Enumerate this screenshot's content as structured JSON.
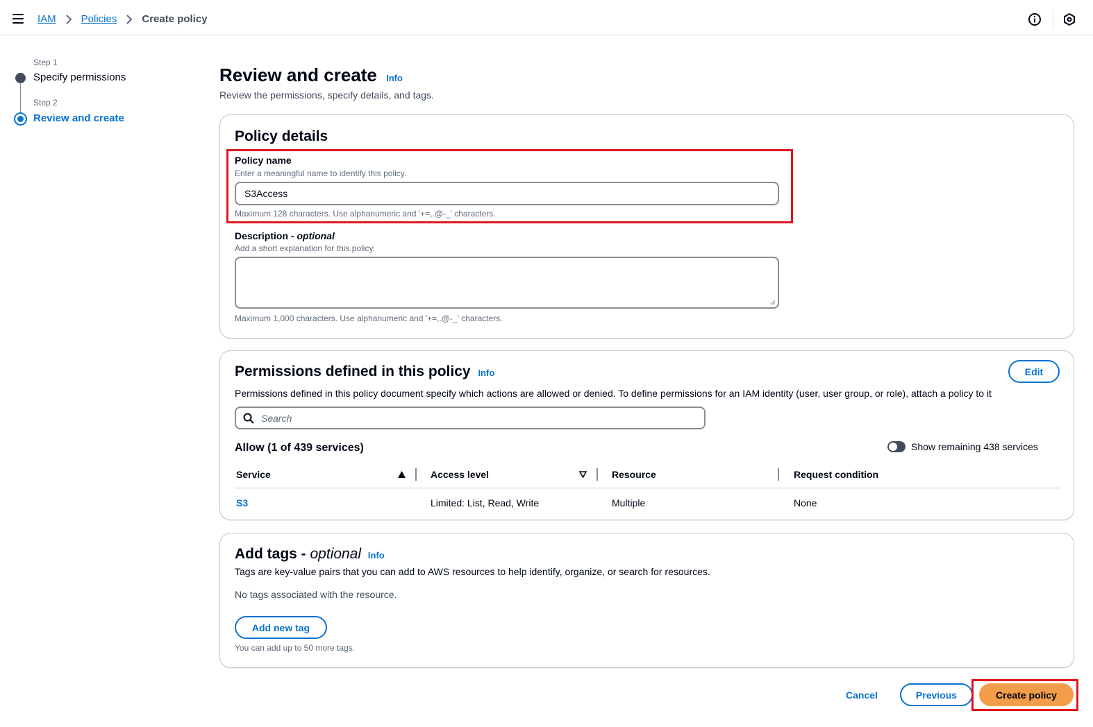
{
  "breadcrumb": {
    "items": [
      "IAM",
      "Policies"
    ],
    "current": "Create policy"
  },
  "steps": [
    {
      "step_label": "Step 1",
      "title": "Specify permissions",
      "state": "completed"
    },
    {
      "step_label": "Step 2",
      "title": "Review and create",
      "state": "current"
    }
  ],
  "page": {
    "title": "Review and create",
    "info": "Info",
    "description": "Review the permissions, specify details, and tags."
  },
  "policy_details": {
    "title": "Policy details",
    "name_label": "Policy name",
    "name_hint": "Enter a meaningful name to identify this policy.",
    "name_value": "S3Access",
    "name_constraint": "Maximum 128 characters. Use alphanumeric and '+=,.@-_' characters.",
    "description_label": "Description - ",
    "description_optional": "optional",
    "description_hint": "Add a short explanation for this policy.",
    "description_value": "",
    "description_constraint": "Maximum 1,000 characters. Use alphanumeric and '+=,.@-_' characters."
  },
  "permissions": {
    "title": "Permissions defined in this policy",
    "info": "Info",
    "edit_label": "Edit",
    "description": "Permissions defined in this policy document specify which actions are allowed or denied. To define permissions for an IAM identity (user, user group, or role), attach a policy to it",
    "search_placeholder": "Search",
    "allow_heading": "Allow (1 of 439 services)",
    "toggle_label": "Show remaining 438 services",
    "toggle_on": false,
    "columns": [
      "Service",
      "Access level",
      "Resource",
      "Request condition"
    ],
    "rows": [
      {
        "service": "S3",
        "access_level": "Limited: List, Read, Write",
        "resource": "Multiple",
        "request_condition": "None"
      }
    ]
  },
  "tags": {
    "title": "Add tags - ",
    "title_optional": "optional",
    "info": "Info",
    "description": "Tags are key-value pairs that you can add to AWS resources to help identify, organize, or search for resources.",
    "empty_text": "No tags associated with the resource.",
    "add_label": "Add new tag",
    "limit_hint": "You can add up to 50 more tags."
  },
  "footer": {
    "cancel_label": "Cancel",
    "previous_label": "Previous",
    "create_label": "Create policy"
  },
  "colors": {
    "link_blue": "#0972d3",
    "primary_orange": "#f29d49",
    "highlight_red": "#e0161e",
    "text_dark": "#000716"
  },
  "icons": [
    "menu-icon",
    "chevron-right-icon",
    "info-circle-icon",
    "settings-icon",
    "search-icon",
    "sort-ascending-icon",
    "sort-descending-icon"
  ]
}
